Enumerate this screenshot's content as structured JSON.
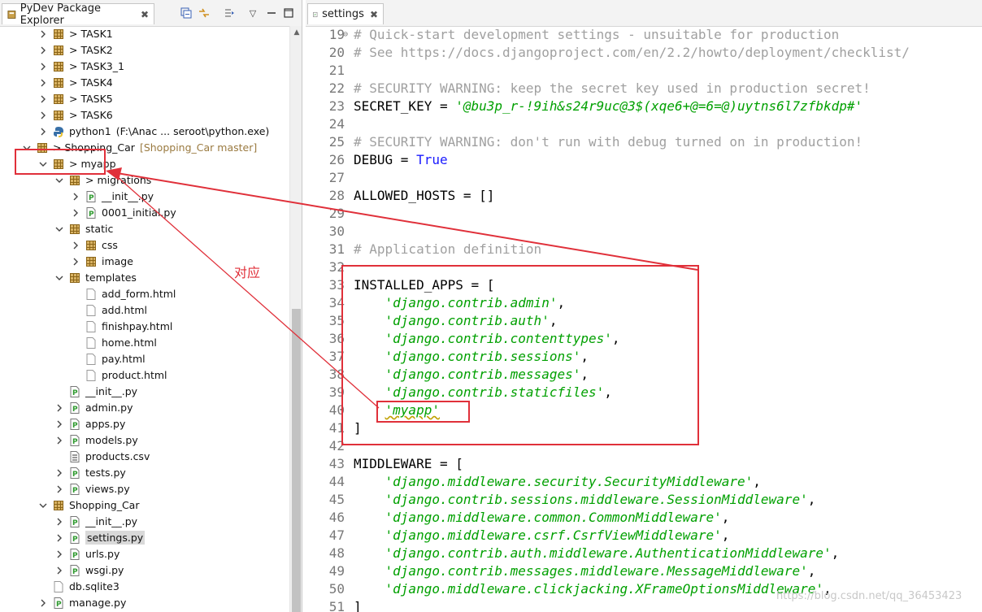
{
  "left_view": {
    "tab_title": "PyDev Package Explorer",
    "tab_close": "✖",
    "toolbar": {
      "collapse_icon": "collapse-all-icon",
      "link_icon": "link-with-editor-icon",
      "focus_icon": "focus-icon",
      "menu_icon": "view-menu-icon",
      "minimize_icon": "minimize-icon",
      "maximize_icon": "maximize-icon"
    },
    "tree": [
      {
        "label": "> TASK1",
        "expanded": false
      },
      {
        "label": "> TASK2",
        "expanded": false
      },
      {
        "label": "> TASK3_1",
        "expanded": false
      },
      {
        "label": "> TASK4",
        "expanded": false
      },
      {
        "label": "> TASK5",
        "expanded": false
      },
      {
        "label": "> TASK6",
        "expanded": false
      },
      {
        "label": "python1",
        "detail": "(F:\\Anac ... seroot\\python.exe)",
        "expanded": false
      },
      {
        "label": "> Shopping_Car",
        "detail": "[Shopping_Car master]",
        "expanded": true
      },
      {
        "label": "> myapp",
        "expanded": true
      },
      {
        "label": "> migrations",
        "expanded": true
      },
      {
        "label": "__init__.py",
        "expanded": false
      },
      {
        "label": "0001_initial.py",
        "expanded": false
      },
      {
        "label": "static",
        "expanded": true
      },
      {
        "label": "css",
        "expanded": false
      },
      {
        "label": "image",
        "expanded": false
      },
      {
        "label": "templates",
        "expanded": true
      },
      {
        "label": "add_form.html"
      },
      {
        "label": "add.html"
      },
      {
        "label": "finishpay.html"
      },
      {
        "label": "home.html"
      },
      {
        "label": "pay.html"
      },
      {
        "label": "product.html"
      },
      {
        "label": "__init__.py"
      },
      {
        "label": "admin.py",
        "expanded": false
      },
      {
        "label": "apps.py",
        "expanded": false
      },
      {
        "label": "models.py",
        "expanded": false
      },
      {
        "label": "products.csv"
      },
      {
        "label": "tests.py",
        "expanded": false
      },
      {
        "label": "views.py",
        "expanded": false
      },
      {
        "label": "Shopping_Car",
        "expanded": true
      },
      {
        "label": "__init__.py",
        "expanded": false
      },
      {
        "label": "settings.py",
        "expanded": false,
        "selected": true
      },
      {
        "label": "urls.py",
        "expanded": false
      },
      {
        "label": "wsgi.py",
        "expanded": false
      },
      {
        "label": "db.sqlite3"
      },
      {
        "label": "manage.py",
        "expanded": false
      }
    ]
  },
  "editor": {
    "tab_title": "settings",
    "tab_close": "✖",
    "lines": [
      {
        "n": "19",
        "parts": [
          {
            "t": "# Quick-start development settings - unsuitable for production",
            "c": "cmt"
          }
        ]
      },
      {
        "n": "20",
        "parts": [
          {
            "t": "# See https://docs.djangoproject.com/en/2.2/howto/deployment/checklist/",
            "c": "cmt"
          }
        ]
      },
      {
        "n": "21",
        "parts": []
      },
      {
        "n": "22",
        "parts": [
          {
            "t": "# SECURITY WARNING: keep the secret key used in production secret!",
            "c": "cmt"
          }
        ]
      },
      {
        "n": "23",
        "parts": [
          {
            "t": "SECRET_KEY = ",
            "c": ""
          },
          {
            "t": "'@bu3p_r-!9ih&s24r9uc@3$(xqe6+@=6=@)uytns6l7zfbkdp#'",
            "c": "str"
          }
        ]
      },
      {
        "n": "24",
        "parts": []
      },
      {
        "n": "25",
        "parts": [
          {
            "t": "# SECURITY WARNING: don't run with debug turned on in production!",
            "c": "cmt"
          }
        ]
      },
      {
        "n": "26",
        "parts": [
          {
            "t": "DEBUG = ",
            "c": ""
          },
          {
            "t": "True",
            "c": "kw"
          }
        ]
      },
      {
        "n": "27",
        "parts": []
      },
      {
        "n": "28",
        "parts": [
          {
            "t": "ALLOWED_HOSTS = []",
            "c": ""
          }
        ]
      },
      {
        "n": "29",
        "parts": []
      },
      {
        "n": "30",
        "parts": []
      },
      {
        "n": "31",
        "parts": [
          {
            "t": "# Application definition",
            "c": "cmt"
          }
        ]
      },
      {
        "n": "32",
        "parts": []
      },
      {
        "n": "33",
        "parts": [
          {
            "t": "INSTALLED_APPS = [",
            "c": ""
          }
        ]
      },
      {
        "n": "34",
        "parts": [
          {
            "t": "    ",
            "c": ""
          },
          {
            "t": "'django.contrib.admin'",
            "c": "str"
          },
          {
            "t": ",",
            "c": ""
          }
        ]
      },
      {
        "n": "35",
        "parts": [
          {
            "t": "    ",
            "c": ""
          },
          {
            "t": "'django.contrib.auth'",
            "c": "str"
          },
          {
            "t": ",",
            "c": ""
          }
        ]
      },
      {
        "n": "36",
        "parts": [
          {
            "t": "    ",
            "c": ""
          },
          {
            "t": "'django.contrib.contenttypes'",
            "c": "str"
          },
          {
            "t": ",",
            "c": ""
          }
        ]
      },
      {
        "n": "37",
        "parts": [
          {
            "t": "    ",
            "c": ""
          },
          {
            "t": "'django.contrib.sessions'",
            "c": "str"
          },
          {
            "t": ",",
            "c": ""
          }
        ]
      },
      {
        "n": "38",
        "parts": [
          {
            "t": "    ",
            "c": ""
          },
          {
            "t": "'django.contrib.messages'",
            "c": "str"
          },
          {
            "t": ",",
            "c": ""
          }
        ]
      },
      {
        "n": "39",
        "parts": [
          {
            "t": "    ",
            "c": ""
          },
          {
            "t": "'django.contrib.staticfiles'",
            "c": "str"
          },
          {
            "t": ",",
            "c": ""
          }
        ]
      },
      {
        "n": "40",
        "parts": [
          {
            "t": "    ",
            "c": ""
          },
          {
            "t": "'myapp'",
            "c": "str sq"
          }
        ]
      },
      {
        "n": "41",
        "parts": [
          {
            "t": "]",
            "c": ""
          }
        ]
      },
      {
        "n": "42",
        "parts": []
      },
      {
        "n": "43",
        "parts": [
          {
            "t": "MIDDLEWARE = [",
            "c": ""
          }
        ]
      },
      {
        "n": "44",
        "parts": [
          {
            "t": "    ",
            "c": ""
          },
          {
            "t": "'django.middleware.security.SecurityMiddleware'",
            "c": "str"
          },
          {
            "t": ",",
            "c": ""
          }
        ]
      },
      {
        "n": "45",
        "parts": [
          {
            "t": "    ",
            "c": ""
          },
          {
            "t": "'django.contrib.sessions.middleware.SessionMiddleware'",
            "c": "str"
          },
          {
            "t": ",",
            "c": ""
          }
        ]
      },
      {
        "n": "46",
        "parts": [
          {
            "t": "    ",
            "c": ""
          },
          {
            "t": "'django.middleware.common.CommonMiddleware'",
            "c": "str"
          },
          {
            "t": ",",
            "c": ""
          }
        ]
      },
      {
        "n": "47",
        "parts": [
          {
            "t": "    ",
            "c": ""
          },
          {
            "t": "'django.middleware.csrf.CsrfViewMiddleware'",
            "c": "str"
          },
          {
            "t": ",",
            "c": ""
          }
        ]
      },
      {
        "n": "48",
        "parts": [
          {
            "t": "    ",
            "c": ""
          },
          {
            "t": "'django.contrib.auth.middleware.AuthenticationMiddleware'",
            "c": "str"
          },
          {
            "t": ",",
            "c": ""
          }
        ]
      },
      {
        "n": "49",
        "parts": [
          {
            "t": "    ",
            "c": ""
          },
          {
            "t": "'django.contrib.messages.middleware.MessageMiddleware'",
            "c": "str"
          },
          {
            "t": ",",
            "c": ""
          }
        ]
      },
      {
        "n": "50",
        "parts": [
          {
            "t": "    ",
            "c": ""
          },
          {
            "t": "'django.middleware.clickjacking.XFrameOptionsMiddleware'",
            "c": "str"
          },
          {
            "t": ",",
            "c": ""
          }
        ]
      },
      {
        "n": "51",
        "parts": [
          {
            "t": "]",
            "c": ""
          }
        ]
      }
    ]
  },
  "annotation": {
    "label": "对应",
    "color": "#e0303a"
  },
  "watermark": "https://blog.csdn.net/qq_36453423",
  "colors": {
    "string": "#00a000",
    "comment": "#a0a0a0",
    "keyword": "#1a1aff",
    "annotation_red": "#e0303a",
    "selection": "#d9d9d9"
  }
}
